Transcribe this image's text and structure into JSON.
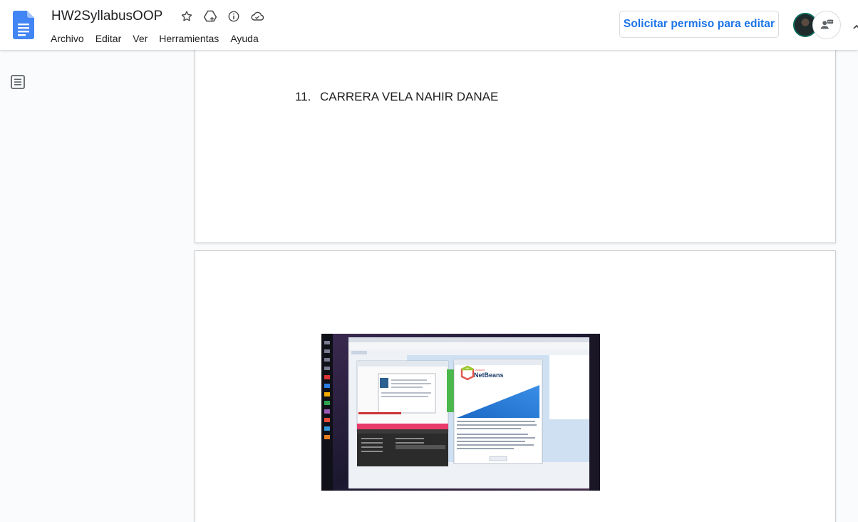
{
  "header": {
    "doc_title": "HW2SyllabusOOP",
    "menu": [
      "Archivo",
      "Editar",
      "Ver",
      "Herramientas",
      "Ayuda"
    ],
    "request_edit_label": "Solicitar permiso para editar",
    "title_icons": [
      "star-icon",
      "move-to-drive-icon",
      "info-icon",
      "cloud-status-icon"
    ]
  },
  "colors": {
    "brand_blue": "#1a73e8",
    "docs_blue": "#4285f4",
    "page_bg": "#f9fbfd",
    "netbeans_blue": "#1b6ac6"
  },
  "document": {
    "list_item": {
      "number": "11.",
      "text": "CARRERA VELA NAHIR DANAE"
    },
    "embedded_image": {
      "description_app": "NetBeans",
      "netbeans_brand_small": "Apache",
      "netbeans_brand": "NetBeans"
    }
  }
}
